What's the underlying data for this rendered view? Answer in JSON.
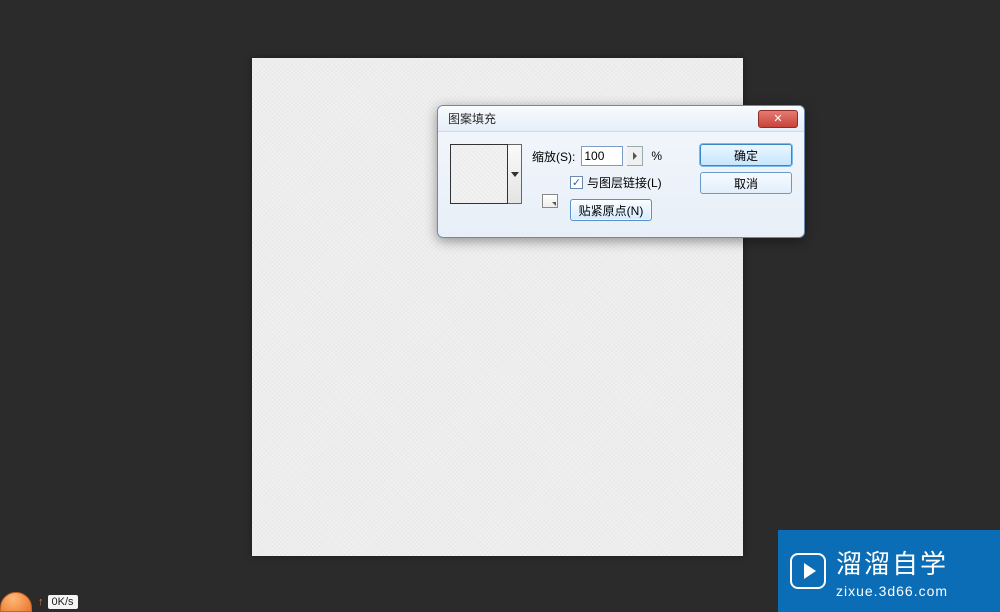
{
  "dialog": {
    "title": "图案填充",
    "scale_label": "缩放(S):",
    "scale_value": "100",
    "percent": "%",
    "link_label": "与图层链接(L)",
    "link_checked": true,
    "snap_label": "贴紧原点(N)",
    "ok_label": "确定",
    "cancel_label": "取消",
    "close_label": "✕"
  },
  "watermark": {
    "main": "溜溜自学",
    "sub": "zixue.3d66.com"
  },
  "taskbar": {
    "upload_arrow": "↑",
    "upload_speed": "0K/s"
  }
}
